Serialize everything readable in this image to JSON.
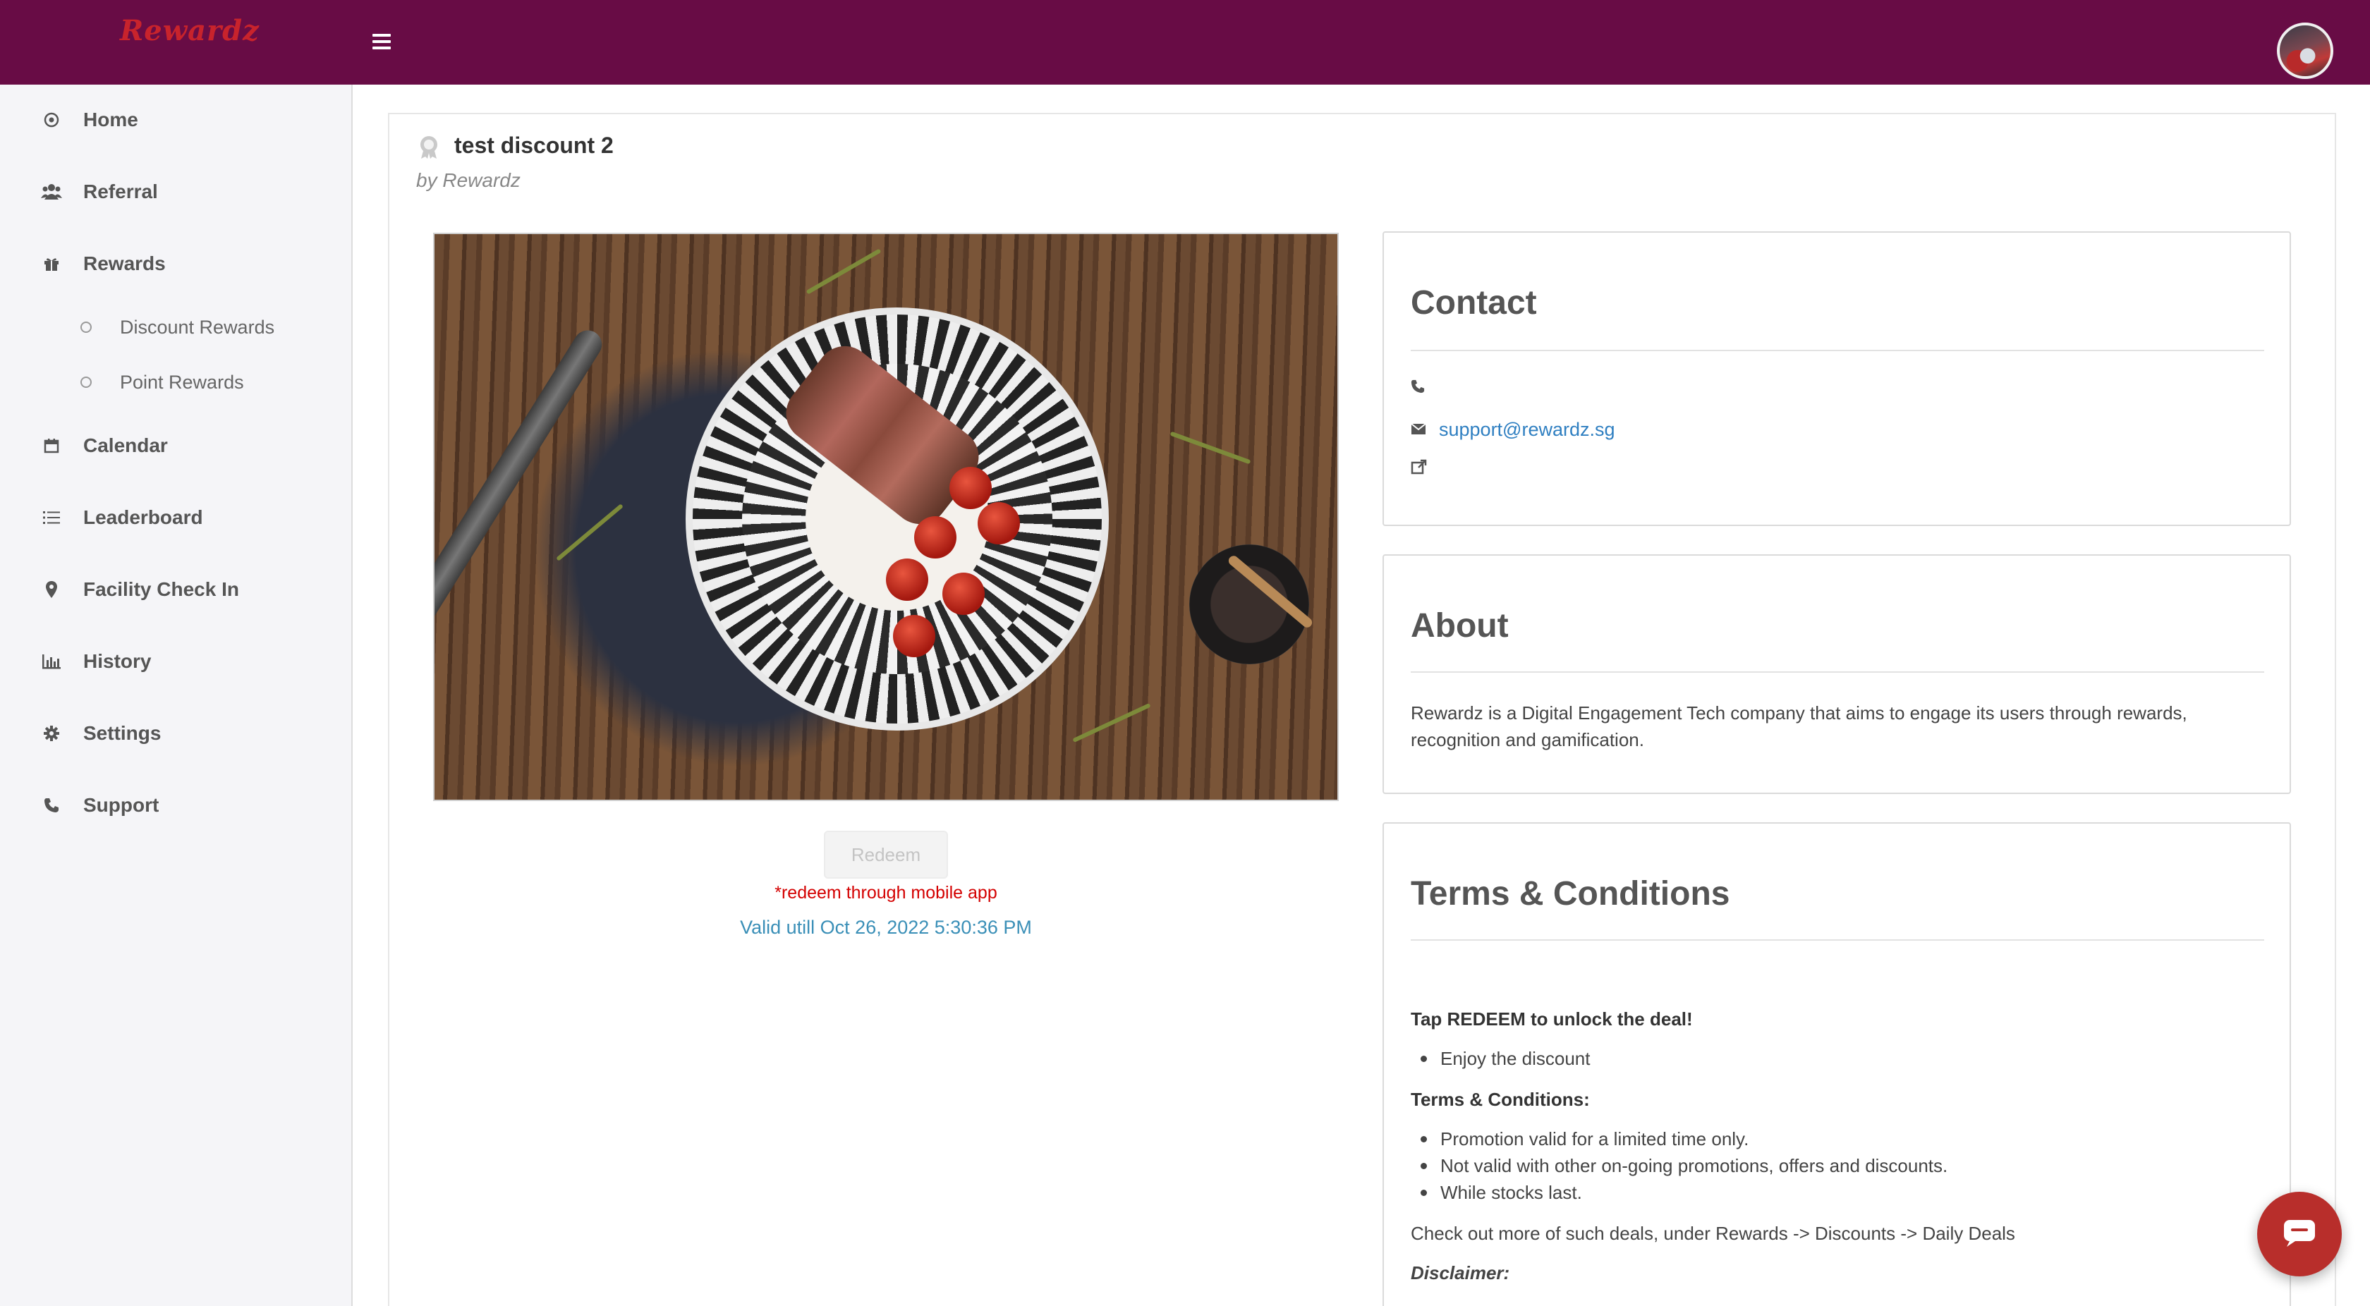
{
  "brand": {
    "logo_text": "Rewardz",
    "primary_color": "#680c45",
    "accent_color": "#c8232c"
  },
  "topbar": {
    "menu_icon": "hamburger-icon",
    "avatar_icon": "user-avatar"
  },
  "sidebar": {
    "items": [
      {
        "label": "Home",
        "icon": "home-icon"
      },
      {
        "label": "Referral",
        "icon": "users-icon"
      },
      {
        "label": "Rewards",
        "icon": "gift-icon"
      },
      {
        "label": "Calendar",
        "icon": "calendar-icon"
      },
      {
        "label": "Leaderboard",
        "icon": "list-icon"
      },
      {
        "label": "Facility Check In",
        "icon": "map-pin-icon"
      },
      {
        "label": "History",
        "icon": "bar-chart-icon"
      },
      {
        "label": "Settings",
        "icon": "gear-icon"
      },
      {
        "label": "Support",
        "icon": "phone-icon"
      }
    ],
    "rewards_subitems": [
      {
        "label": "Discount Rewards"
      },
      {
        "label": "Point Rewards"
      }
    ]
  },
  "reward": {
    "title": "test discount 2",
    "by": "by Rewardz",
    "redeem_label": "Redeem",
    "redeem_note": "*redeem through mobile app",
    "valid_until": "Valid utill Oct 26, 2022 5:30:36 PM"
  },
  "contact": {
    "title": "Contact",
    "phone": "",
    "email": "support@rewardz.sg",
    "website": ""
  },
  "about": {
    "title": "About",
    "text": "Rewardz is a Digital Engagement Tech company that aims to engage its users through rewards, recognition and gamification."
  },
  "terms": {
    "title": "Terms & Conditions",
    "heading1": "Tap REDEEM to unlock the deal!",
    "list1": [
      "Enjoy the discount"
    ],
    "heading2": "Terms & Conditions:",
    "list2": [
      "Promotion valid for a limited time only.",
      "Not valid with other on-going promotions, offers and discounts.",
      "While stocks last."
    ],
    "more_text": "Check out more of such deals, under Rewards -> Discounts -> Daily Deals",
    "disclaimer": "Disclaimer:"
  }
}
